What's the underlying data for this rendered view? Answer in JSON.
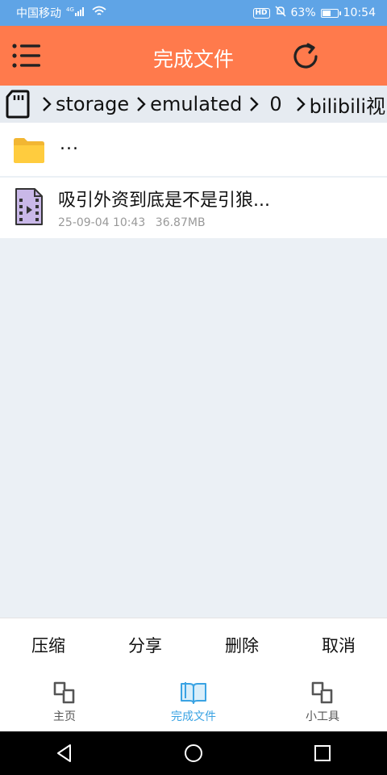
{
  "status_bar": {
    "carrier": "中国移动",
    "network": "4G",
    "battery_percent": "63%",
    "battery_level": 0.63,
    "time": "10:54",
    "icons": [
      "signal-icon",
      "wifi-icon",
      "hd-icon",
      "mute-bell-icon",
      "battery-icon"
    ]
  },
  "header": {
    "title": "完成文件",
    "left_icon": "menu-icon",
    "right_icon": "refresh-icon",
    "bg_color": "#ff7a4c"
  },
  "path": {
    "root_icon": "sd-card-icon",
    "segments": [
      "storage",
      "emulated",
      "0",
      "bilibili视"
    ]
  },
  "files": {
    "parent_label": "...",
    "items": [
      {
        "name": "吸引外资到底是不是引狼...",
        "date": "25-09-04 10:43",
        "size": "36.87MB",
        "icon": "video-file-icon"
      }
    ]
  },
  "actions": [
    "压缩",
    "分享",
    "删除",
    "取消"
  ],
  "tabs": [
    {
      "label": "主页",
      "icon": "home-squares-icon",
      "active": false
    },
    {
      "label": "完成文件",
      "icon": "book-icon",
      "active": true
    },
    {
      "label": "小工具",
      "icon": "tools-squares-icon",
      "active": false
    }
  ],
  "accent_color": "#3aa3e3"
}
